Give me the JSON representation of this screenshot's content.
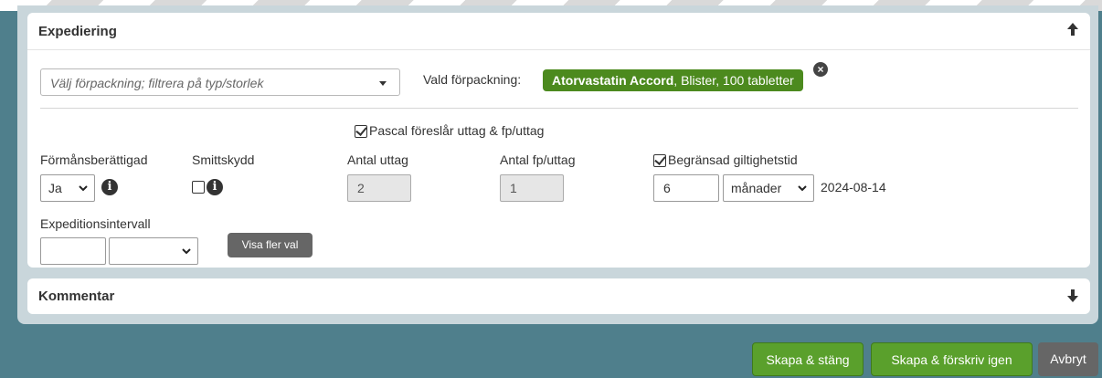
{
  "expediering": {
    "title": "Expediering",
    "package_placeholder": "Välj förpackning; filtrera på typ/storlek",
    "chosen_label": "Vald förpackning:",
    "chosen_name": "Atorvastatin Accord",
    "chosen_details": ", Blister, 100 tabletter",
    "remove_symbol": "×",
    "pascal_label": "Pascal föreslår uttag & fp/uttag",
    "pascal_checked": true,
    "formansberattigad": {
      "label": "Förmånsberättigad",
      "value": "Ja"
    },
    "smittskydd": {
      "label": "Smittskydd",
      "checked": false
    },
    "antal_uttag": {
      "label": "Antal uttag",
      "value": "2"
    },
    "antal_fp_uttag": {
      "label": "Antal fp/uttag",
      "value": "1"
    },
    "begransad": {
      "label": "Begränsad giltighetstid",
      "checked": true,
      "amount": "6",
      "unit": "månader",
      "date": "2024-08-14"
    },
    "intervall": {
      "label": "Expeditionsintervall",
      "value": "",
      "unit": ""
    },
    "more_button": "Visa fler val"
  },
  "kommentar": {
    "title": "Kommentar"
  },
  "footer": {
    "create_close": "Skapa & stäng",
    "create_prescribe": "Skapa & förskriv igen",
    "cancel": "Avbryt"
  },
  "colors": {
    "background": "#4f7f8c",
    "chip": "#4c8a1e",
    "primary_button": "#5aa02c",
    "secondary_button": "#666666"
  }
}
